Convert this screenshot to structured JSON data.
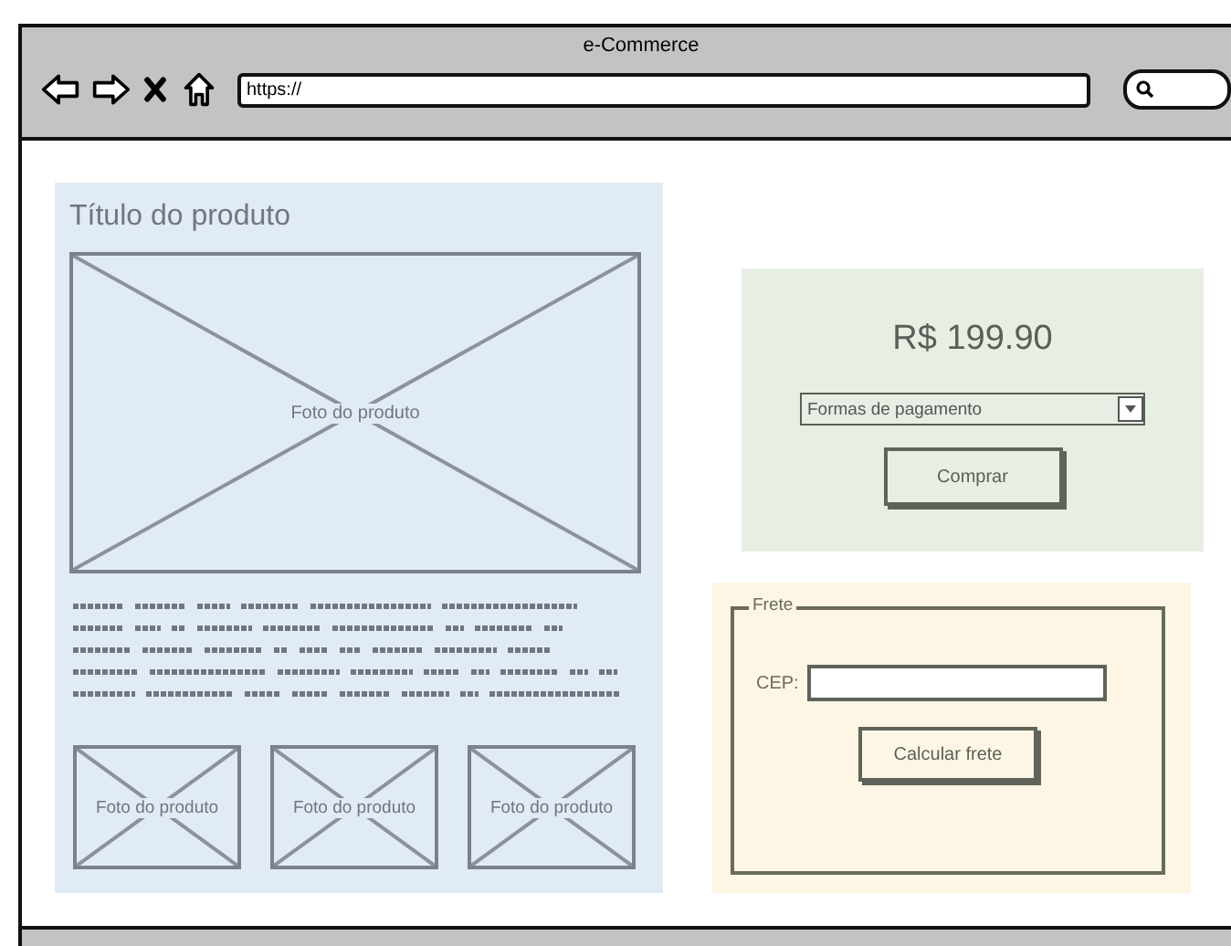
{
  "window": {
    "title": "e-Commerce",
    "address": "https://"
  },
  "product": {
    "title": "Título do produto",
    "main_photo": "Foto do produto",
    "thumbnails": [
      "Foto do produto",
      "Foto do produto",
      "Foto do produto"
    ]
  },
  "purchase": {
    "price": "R$ 199.90",
    "payment_select": "Formas de pagamento",
    "buy_button": "Comprar"
  },
  "shipping": {
    "legend": "Frete",
    "cep_label": "CEP:",
    "button": "Calcular frete"
  }
}
